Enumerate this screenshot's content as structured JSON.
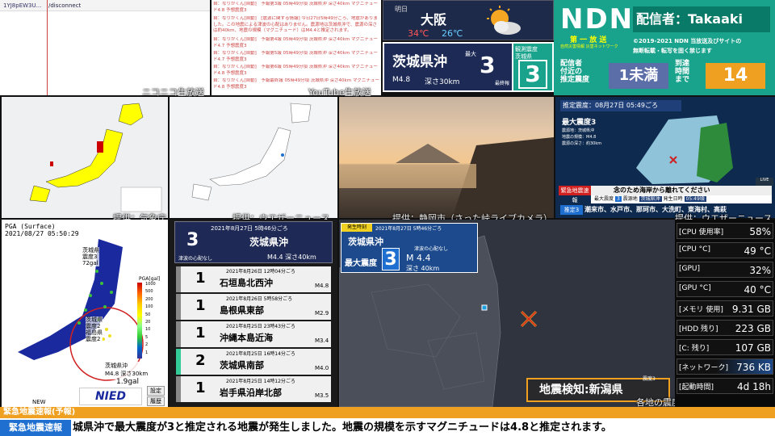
{
  "chat": {
    "link_id": "1YJ8pEW3U...",
    "link_path": "/disconnect",
    "messages": [
      "自：なりかくん[自動]　予報第3報 05時49分頃 茨城県沖 深さ40km マグニチュード4.8 予想震度3",
      "自：なりかくん[自動]　[震源に関する情報] 今日27日5時49分ごろ、地震がありました。この地震による津波の心配はありません。震源地は茨城県沖で、震源の深さは約40km、地震の規模（マグニチュード）はM4.4と推定されます。",
      "自：なりかくん[自動]　予報第4報 05時49分頃 茨城県沖 深さ40km マグニチュード4.7 予想震度3",
      "自：なりかくん[自動]　予報第5報 05時49分頃 茨城県沖 深さ40km マグニチュード4.7 予想震度3",
      "自：なりかくん[自動]　予報第6報 05時49分頃 茨城県沖 深さ40km マグニチュード4.8 予想震度3",
      "自：なりかくん[自動]　予報最終報 05時49分頃 茨城県沖 深さ40km マグニチュード4.8 予想震度3"
    ],
    "caption_left": "ニコニコ生放送",
    "caption_right": "YouTube生放送"
  },
  "weather": {
    "label": "明日",
    "city": "大阪",
    "high": "34℃",
    "low": "26℃"
  },
  "quake_head": {
    "region": "茨城県沖",
    "max_label": "最大",
    "max_intensity": "3",
    "final_label": "最終報",
    "magnitude": "M4.8",
    "depth": "深さ30km",
    "obs_label_1": "観測震度",
    "obs_label_2": "茨城県",
    "obs_intensity": "3"
  },
  "ndn": {
    "logo": "NDN",
    "broadcaster": "配信者：Takaaki",
    "sub_title": "第 一 放 送",
    "sub_caption": "自然災害情報 災害ネットワーク",
    "copyright": "©2019-2021 NDN 当放送及びサイトの",
    "copyright_2": "無断転載・転写を固く禁じます",
    "est_label_1": "配信者",
    "est_label_2": "付近の",
    "est_label_3": "推定震度",
    "est_value": "1未満",
    "arr_label_1": "到達",
    "arr_label_2": "時間",
    "arr_label_3": "まで",
    "arr_value": "14"
  },
  "captions": {
    "map1": "提供：気象庁",
    "map2": "提供：ウエザーニュース",
    "live": "提供：静岡市（さった峠ライブカメラ）",
    "tv": "提供：ウエザーニュース",
    "epi": "各地の震度"
  },
  "tv": {
    "estimated": "推定震度：08月27日 05:49ごろ",
    "max_label": "最大震度3",
    "epicenter_label": "震源地：茨城県沖",
    "magnitude_label": "地震の規模：M4.8",
    "depth_label": "震源の深さ：約30km",
    "warning_label": "緊急地震速報",
    "warning_text": "念のため海岸から離れてください",
    "detail_max": "最大震度",
    "detail_max_val": "3",
    "detail_epi": "震源地",
    "detail_epi_val": "茨城県沖",
    "detail_time": "発生日時",
    "detail_time_val": "05:49頃",
    "bottom_badge": "推定3",
    "bottom_cities": "潮来市、水戸市、那珂市、大洗町、東海村、高萩",
    "live_badge": "LIVE"
  },
  "pga": {
    "title": "PGA (Surface)",
    "date": "2021/08/27 05:50:29",
    "scale_title": "PGA[gal]",
    "scale_values": [
      "1000",
      "500",
      "200",
      "100",
      "50",
      "20",
      "10",
      "5",
      "2",
      "1"
    ],
    "gal_value": "1.9gal",
    "new_label": "NEW",
    "nied": "NIED",
    "btn_settings": "設定",
    "btn_history": "履歴",
    "quake_box_region": "茨城県沖",
    "quake_box_mag": "M4.8 深さ30km",
    "labels": [
      "茨城県",
      "震度3",
      "72gal",
      "茨城県",
      "震度2",
      "福島県",
      "震度2"
    ]
  },
  "eq_list": {
    "top_date": "2021年8月27日 5時46分ごろ",
    "top_intensity": "3",
    "top_region": "茨城県沖",
    "top_tsunami": "津波の心配なし",
    "top_mag": "M4.4 深さ40km",
    "items": [
      {
        "date": "2021年8月26日 12時04分ごろ",
        "intensity": "1",
        "region": "石垣島北西沖",
        "mag": "M4.8"
      },
      {
        "date": "2021年8月26日 5時58分ごろ",
        "intensity": "1",
        "region": "島根県東部",
        "mag": "M2.9"
      },
      {
        "date": "2021年8月25日 23時43分ごろ",
        "intensity": "1",
        "region": "沖縄本島近海",
        "mag": "M3.4"
      },
      {
        "date": "2021年8月25日 16時14分ごろ",
        "intensity": "2",
        "region": "茨城県南部",
        "mag": "M4.0"
      },
      {
        "date": "2021年8月25日 14時12分ごろ",
        "intensity": "1",
        "region": "岩手県沿岸北部",
        "mag": "M3.5"
      }
    ]
  },
  "epi": {
    "time_label": "発生時刻",
    "time": "2021年8月27日 5時46分ごろ",
    "region": "茨城県沖",
    "tsunami": "津波の心配なし",
    "max_label": "最大震度",
    "max_val": "3",
    "mag": "M 4.4",
    "depth": "深さ 40km",
    "detect": "地震検知:新潟県",
    "intensity_small": "震度3"
  },
  "sys": {
    "rows": [
      {
        "label": "[CPU 使用率]",
        "value": "58%"
      },
      {
        "label": "[CPU °C]",
        "value": "49 °C"
      },
      {
        "label": "[GPU]",
        "value": "32%"
      },
      {
        "label": "[GPU °C]",
        "value": "40 °C"
      },
      {
        "label": "[メモリ 使用]",
        "value": "9.31 GB"
      },
      {
        "label": "[HDD 残り]",
        "value": "223 GB"
      },
      {
        "label": "[C: 残り]",
        "value": "107 GB"
      },
      {
        "label": "[ネットワーク]",
        "value": "736 KB"
      },
      {
        "label": "[起動時間]",
        "value": "4d 18h"
      }
    ]
  },
  "ticker": {
    "header": "緊急地震速報(予報)",
    "badge": "緊急地震速報",
    "text": "城県沖で最大震度が3と推定される地震が発生しました。地震の規模を示すマグニチュードは4.8と推定されます。"
  },
  "colors": {
    "ndn_teal": "#1aa38c",
    "warning_orange": "#f0a020",
    "intensity3_blue": "#1e6fd0",
    "alert_red": "#d02020"
  }
}
